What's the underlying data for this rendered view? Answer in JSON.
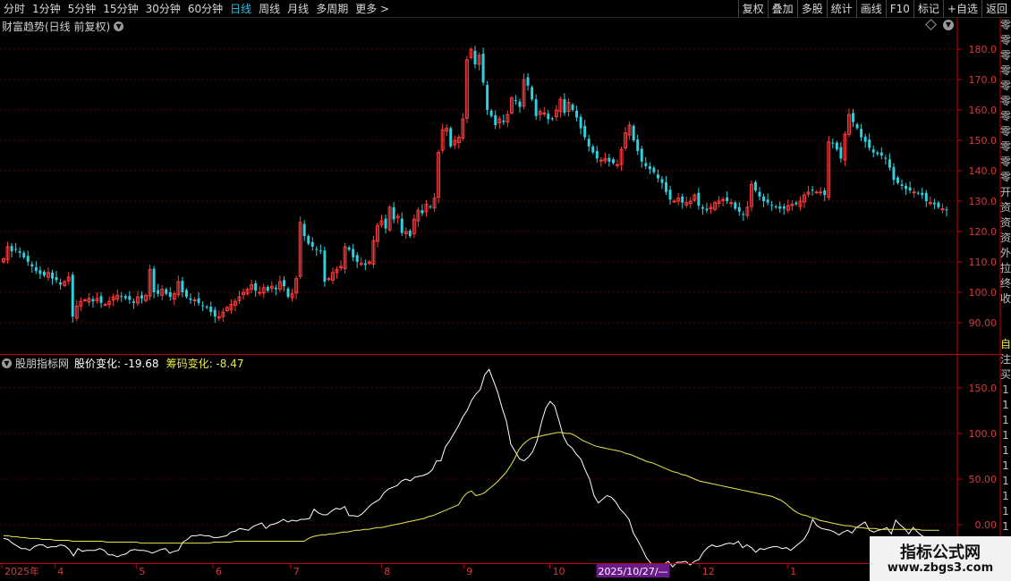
{
  "toolbar": {
    "periods": [
      {
        "label": "分时",
        "active": false
      },
      {
        "label": "1分钟",
        "active": false
      },
      {
        "label": "5分钟",
        "active": false
      },
      {
        "label": "15分钟",
        "active": false
      },
      {
        "label": "30分钟",
        "active": false
      },
      {
        "label": "60分钟",
        "active": false
      },
      {
        "label": "日线",
        "active": true
      },
      {
        "label": "周线",
        "active": false
      },
      {
        "label": "月线",
        "active": false
      },
      {
        "label": "多周期",
        "active": false
      },
      {
        "label": "更多 >",
        "active": false
      }
    ],
    "tools": [
      "复权",
      "叠加",
      "多股",
      "统计",
      "画线",
      "F10",
      "标记",
      "+自选",
      "返回"
    ]
  },
  "price_panel": {
    "title": "财富趋势(日线 前复权)"
  },
  "indicator_panel": {
    "name": "股朋指标网",
    "price_change_label": "股价变化: -19.68",
    "chip_change_label": "筹码变化: -8.47"
  },
  "x_axis": {
    "labels": [
      {
        "text": "2025年",
        "pos": 0
      },
      {
        "text": "4",
        "pos": 0.056
      },
      {
        "text": "5",
        "pos": 0.142
      },
      {
        "text": "6",
        "pos": 0.223
      },
      {
        "text": "7",
        "pos": 0.305
      },
      {
        "text": "8",
        "pos": 0.401
      },
      {
        "text": "9",
        "pos": 0.488
      },
      {
        "text": "10",
        "pos": 0.579
      },
      {
        "text": "2025/10/27/—",
        "pos": 0.63,
        "highlight": true
      },
      {
        "text": "12",
        "pos": 0.737
      },
      {
        "text": "1",
        "pos": 0.83
      }
    ]
  },
  "right_strip": [
    "零",
    "零",
    "零",
    "零",
    "零",
    "零",
    "零",
    "零",
    "零",
    "零",
    "零",
    "开",
    "资",
    "资",
    "资",
    "外",
    "拉",
    "终",
    "收",
    "",
    "",
    "自",
    "注",
    "买",
    "1",
    "1",
    "1",
    "1",
    "1",
    "1",
    "1",
    "1",
    "1",
    "1"
  ],
  "watermark": {
    "title": "指标公式网",
    "url": "www.zbgs3.com"
  },
  "colors": {
    "up": "#ff3b3b",
    "down": "#2fd1e0",
    "grid": "#5a0000",
    "axis": "#c80000",
    "white_line": "#ffffff",
    "yellow_line": "#e8e84a",
    "active": "#2fc1e8"
  },
  "chart_data": [
    {
      "type": "candlestick",
      "title": "财富趋势(日线 前复权)",
      "ylim": [
        80,
        185
      ],
      "yticks": [
        90,
        100,
        110,
        120,
        130,
        140,
        150,
        160,
        170,
        180
      ],
      "ytick_labels": [
        "90.00",
        "100.0",
        "110.0",
        "120.0",
        "130.0",
        "140.0",
        "150.0",
        "160.0",
        "170.0",
        "180.0"
      ],
      "close": [
        111.0,
        115.0,
        113.5,
        114.0,
        113.0,
        111.5,
        110.0,
        108.5,
        107.0,
        106.0,
        105.5,
        106.5,
        104.5,
        104.0,
        102.5,
        103.5,
        105.0,
        92.0,
        95.5,
        97.0,
        97.5,
        98.0,
        97.0,
        98.0,
        96.5,
        96.0,
        97.0,
        98.5,
        99.0,
        98.5,
        98.0,
        97.5,
        96.5,
        98.5,
        98.0,
        99.0,
        107.5,
        100.0,
        99.5,
        101.0,
        99.5,
        98.5,
        99.5,
        103.5,
        100.0,
        98.5,
        97.5,
        97.5,
        96.5,
        95.5,
        95.0,
        93.5,
        92.0,
        92.0,
        93.5,
        95.0,
        96.0,
        97.0,
        98.5,
        100.0,
        101.0,
        102.5,
        100.5,
        100.0,
        101.5,
        100.5,
        102.0,
        101.0,
        103.5,
        102.0,
        98.5,
        99.5,
        104.5,
        123.0,
        118.5,
        116.0,
        115.0,
        114.0,
        113.5,
        103.5,
        104.5,
        106.5,
        107.5,
        108.5,
        115.0,
        114.0,
        111.5,
        110.0,
        109.5,
        109.0,
        110.0,
        117.0,
        122.0,
        123.5,
        121.0,
        128.0,
        124.0,
        125.0,
        119.5,
        120.0,
        118.5,
        124.0,
        127.0,
        126.0,
        129.0,
        128.0,
        131.0,
        146.0,
        153.5,
        154.0,
        148.0,
        150.0,
        151.0,
        157.0,
        176.5,
        180.0,
        175.0,
        178.0,
        169.0,
        160.0,
        158.0,
        155.0,
        157.0,
        156.0,
        158.5,
        164.0,
        163.0,
        161.0,
        170.0,
        168.0,
        163.5,
        158.0,
        159.5,
        159.0,
        157.0,
        157.0,
        160.0,
        163.5,
        159.0,
        162.5,
        160.0,
        157.5,
        154.0,
        151.0,
        148.0,
        146.0,
        144.0,
        143.5,
        144.0,
        143.0,
        142.5,
        142.0,
        147.0,
        152.5,
        155.0,
        150.0,
        146.5,
        143.0,
        141.5,
        140.5,
        139.5,
        137.5,
        136.0,
        133.0,
        130.5,
        130.0,
        131.0,
        129.5,
        129.5,
        130.0,
        132.0,
        128.5,
        127.5,
        127.0,
        128.0,
        129.5,
        130.0,
        130.5,
        130.0,
        129.5,
        127.5,
        126.5,
        125.5,
        128.0,
        135.5,
        133.5,
        131.5,
        130.0,
        129.5,
        128.5,
        128.0,
        127.5,
        127.5,
        128.5,
        129.0,
        129.0,
        130.0,
        132.0,
        133.0,
        133.5,
        133.0,
        133.0,
        132.0,
        149.5,
        149.0,
        147.0,
        144.0,
        152.0,
        158.5,
        156.0,
        154.0,
        151.0,
        149.5,
        147.5,
        146.0,
        145.5,
        145.0,
        144.0,
        141.0,
        137.0,
        136.0,
        135.0,
        134.0,
        133.5,
        133.0,
        132.5,
        132.0,
        130.0,
        129.5,
        129.0,
        128.0,
        127.5,
        127.0
      ]
    },
    {
      "type": "line",
      "title": "股朋指标网",
      "ylim": [
        -40,
        185
      ],
      "yticks": [
        0,
        50,
        100,
        150
      ],
      "ytick_labels": [
        "0.00",
        "50.00",
        "100.0",
        "150.0"
      ],
      "series": [
        {
          "name": "股价变化",
          "values": [
            -15,
            -16,
            -20,
            -23,
            -26,
            -26,
            -28,
            -24,
            -22,
            -22,
            -25,
            -24,
            -24,
            -22,
            -23,
            -27,
            -34,
            -26,
            -29,
            -28,
            -28,
            -28,
            -26,
            -28,
            -33,
            -33,
            -35,
            -33,
            -32,
            -28,
            -27,
            -28,
            -28,
            -29,
            -31,
            -29,
            -27,
            -26,
            -31,
            -29,
            -28,
            -19,
            -16,
            -12,
            -12,
            -11,
            -12,
            -12,
            -14,
            -14,
            -13,
            -12,
            -8,
            -7,
            -4,
            -5,
            -6,
            -2,
            0,
            2,
            -4,
            0,
            1,
            3,
            6,
            3,
            5,
            4,
            6,
            6,
            7,
            17,
            13,
            11,
            11,
            15,
            18,
            17,
            20,
            10,
            10,
            9,
            12,
            17,
            22,
            25,
            28,
            35,
            39,
            41,
            43,
            48,
            50,
            48,
            52,
            53,
            54,
            56,
            60,
            70,
            70,
            85,
            92,
            100,
            108,
            118,
            125,
            136,
            143,
            148,
            164,
            170,
            158,
            145,
            128,
            113,
            88,
            80,
            72,
            70,
            74,
            80,
            92,
            112,
            128,
            135,
            130,
            114,
            97,
            88,
            84,
            77,
            72,
            60,
            50,
            32,
            24,
            28,
            32,
            30,
            25,
            17,
            12,
            6,
            -9,
            -17,
            -26,
            -36,
            -42,
            -44,
            -45,
            -43,
            -40,
            -46,
            -41,
            -41,
            -40,
            -44,
            -40,
            -38,
            -30,
            -25,
            -22,
            -24,
            -23,
            -21,
            -20,
            -21,
            -18,
            -25,
            -22,
            -25,
            -30,
            -26,
            -27,
            -25,
            -24,
            -24,
            -26,
            -25,
            -28,
            -24,
            -20,
            -16,
            -8,
            6,
            -1,
            -4,
            -5,
            -6,
            -8,
            -11,
            -8,
            -6,
            -9,
            -3,
            0,
            3,
            -6,
            -8,
            -6,
            -5,
            -3,
            -10,
            5,
            0,
            -4,
            -10,
            -3,
            -8,
            -12,
            -14,
            -15,
            -18,
            -20
          ]
        },
        {
          "name": "筹码变化",
          "values": [
            -12,
            -12,
            -13,
            -13,
            -14,
            -14,
            -15,
            -15,
            -15,
            -16,
            -16,
            -16,
            -17,
            -17,
            -17,
            -17,
            -18,
            -18,
            -18,
            -18,
            -18,
            -18,
            -18,
            -18,
            -19,
            -19,
            -19,
            -19,
            -19,
            -19,
            -19,
            -19,
            -20,
            -20,
            -20,
            -20,
            -20,
            -20,
            -20,
            -20,
            -20,
            -20,
            -20,
            -20,
            -20,
            -20,
            -20,
            -20,
            -20,
            -19,
            -19,
            -19,
            -19,
            -19,
            -18,
            -18,
            -18,
            -18,
            -18,
            -18,
            -18,
            -18,
            -18,
            -18,
            -18,
            -18,
            -18,
            -18,
            -18,
            -18,
            -18,
            -15,
            -13,
            -12,
            -11,
            -11,
            -10,
            -10,
            -9,
            -8,
            -8,
            -7,
            -6,
            -6,
            -5,
            -5,
            -4,
            -3,
            -3,
            -2,
            -1,
            0,
            1,
            2,
            3,
            4,
            5,
            6,
            7,
            9,
            10,
            12,
            14,
            16,
            18,
            20,
            22,
            30,
            35,
            37,
            32,
            33,
            35,
            39,
            43,
            47,
            52,
            57,
            64,
            72,
            82,
            88,
            92,
            95,
            96,
            97,
            98,
            99,
            100,
            101,
            101,
            100,
            100,
            98,
            95,
            92,
            90,
            88,
            86,
            85,
            84,
            83,
            82,
            81,
            80,
            78,
            77,
            75,
            73,
            71,
            69,
            68,
            66,
            64,
            62,
            60,
            58,
            57,
            55,
            54,
            52,
            50,
            48,
            47,
            46,
            45,
            44,
            43,
            42,
            41,
            40,
            39,
            38,
            37,
            36,
            35,
            34,
            33,
            32,
            31,
            29,
            27,
            24,
            20,
            16,
            13,
            11,
            10,
            8,
            7,
            5,
            4,
            3,
            2,
            1,
            0,
            -1,
            -1,
            -2,
            -3,
            -3,
            -4,
            -4,
            -4,
            -5,
            -5,
            -5,
            -5,
            -5,
            -5,
            -5,
            -5,
            -5,
            -5,
            -6,
            -6,
            -6,
            -6,
            -6
          ]
        }
      ]
    }
  ]
}
